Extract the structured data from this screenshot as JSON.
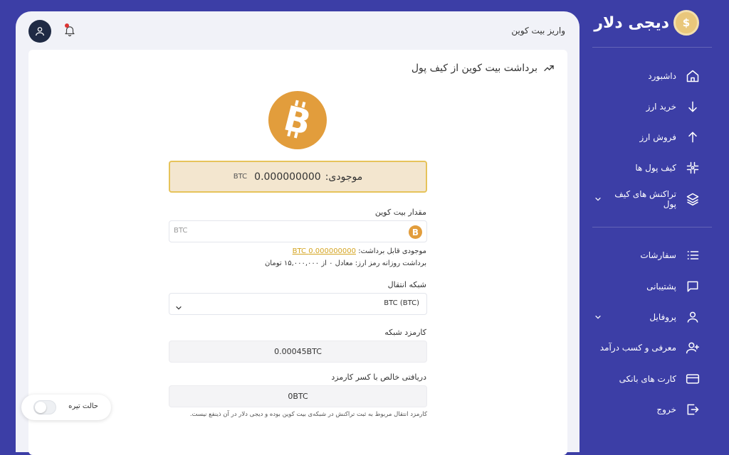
{
  "brand": {
    "name": "دیجی دلار"
  },
  "sidebar": {
    "items": [
      {
        "label": "داشبورد",
        "icon": "home-icon"
      },
      {
        "label": "خرید ارز",
        "icon": "arrow-down-icon"
      },
      {
        "label": "فروش ارز",
        "icon": "arrow-up-icon"
      },
      {
        "label": "کیف پول ها",
        "icon": "wallet-grid-icon"
      },
      {
        "label": "تراکنش های کیف پول",
        "icon": "layers-icon"
      },
      {
        "label": "سفارشات",
        "icon": "list-icon"
      },
      {
        "label": "پشتیبانی",
        "icon": "chat-icon"
      },
      {
        "label": "پروفایل",
        "icon": "user-icon"
      },
      {
        "label": "معرفی و کسب درآمد",
        "icon": "user-plus-icon"
      },
      {
        "label": "کارت های بانکی",
        "icon": "card-icon"
      },
      {
        "label": "خروج",
        "icon": "logout-icon"
      }
    ]
  },
  "header": {
    "page_title": "واریز بیت کوین"
  },
  "card": {
    "title": "برداشت بیت کوین از کیف پول",
    "balance_label": "موجودی:",
    "balance_value": "0.000000000",
    "balance_unit": "BTC"
  },
  "form": {
    "amount_label": "مقدار بیت کوین",
    "amount_placeholder": "BTC",
    "withdrawable_label": "موجودی قابل برداشت:",
    "withdrawable_value": "0.000000000 BTC",
    "daily_limit_text": "برداشت روزانه رمز ارز: معادل ۰ از ۱۵,۰۰۰,۰۰۰ تومان",
    "network_label": "شبکه انتقال",
    "network_value": "BTC (BTC)",
    "fee_label": "کارمزد شبکه",
    "fee_value": "0.00045BTC",
    "net_label": "دریافتی خالص با کسر کارمزد",
    "net_value": "0BTC",
    "fee_note": "کارمزد انتقال مربوط به ثبت تراکنش در شبکه‌ی بیت کوین بوده و دیجی دلار در آن ذینفع نیست."
  },
  "dark_mode": {
    "label": "حالت تیره",
    "enabled": false
  },
  "colors": {
    "sidebar_bg": "#3c3ea6",
    "bitcoin": "#e29d3c",
    "balance_bg": "#f3e6cf",
    "accent": "#d4a420"
  }
}
